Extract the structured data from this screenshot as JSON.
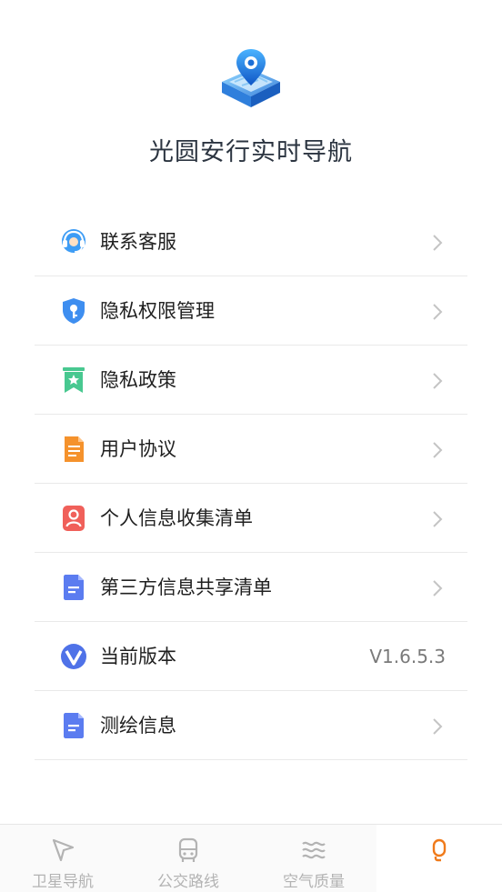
{
  "app": {
    "title": "光圆安行实时导航"
  },
  "menu": {
    "items": [
      {
        "label": "联系客服",
        "icon": "headset-icon"
      },
      {
        "label": "隐私权限管理",
        "icon": "shield-key-icon"
      },
      {
        "label": "隐私政策",
        "icon": "bookmark-star-icon"
      },
      {
        "label": "用户协议",
        "icon": "document-icon"
      },
      {
        "label": "个人信息收集清单",
        "icon": "person-card-icon"
      },
      {
        "label": "第三方信息共享清单",
        "icon": "file-icon"
      },
      {
        "label": "当前版本",
        "icon": "v-badge-icon",
        "value": "V1.6.5.3"
      },
      {
        "label": "测绘信息",
        "icon": "file-icon"
      }
    ]
  },
  "tabbar": {
    "tabs": [
      {
        "label": "卫星导航",
        "icon": "navigation-arrow-icon"
      },
      {
        "label": "公交路线",
        "icon": "bus-icon"
      },
      {
        "label": "空气质量",
        "icon": "waves-icon"
      },
      {
        "label": "",
        "icon": "profile-icon",
        "active": true
      }
    ]
  },
  "colors": {
    "accent": "#f07a1a",
    "inactive": "#b3b3b3",
    "divider": "#e9e9e9",
    "chevron": "#c4c4c4"
  }
}
